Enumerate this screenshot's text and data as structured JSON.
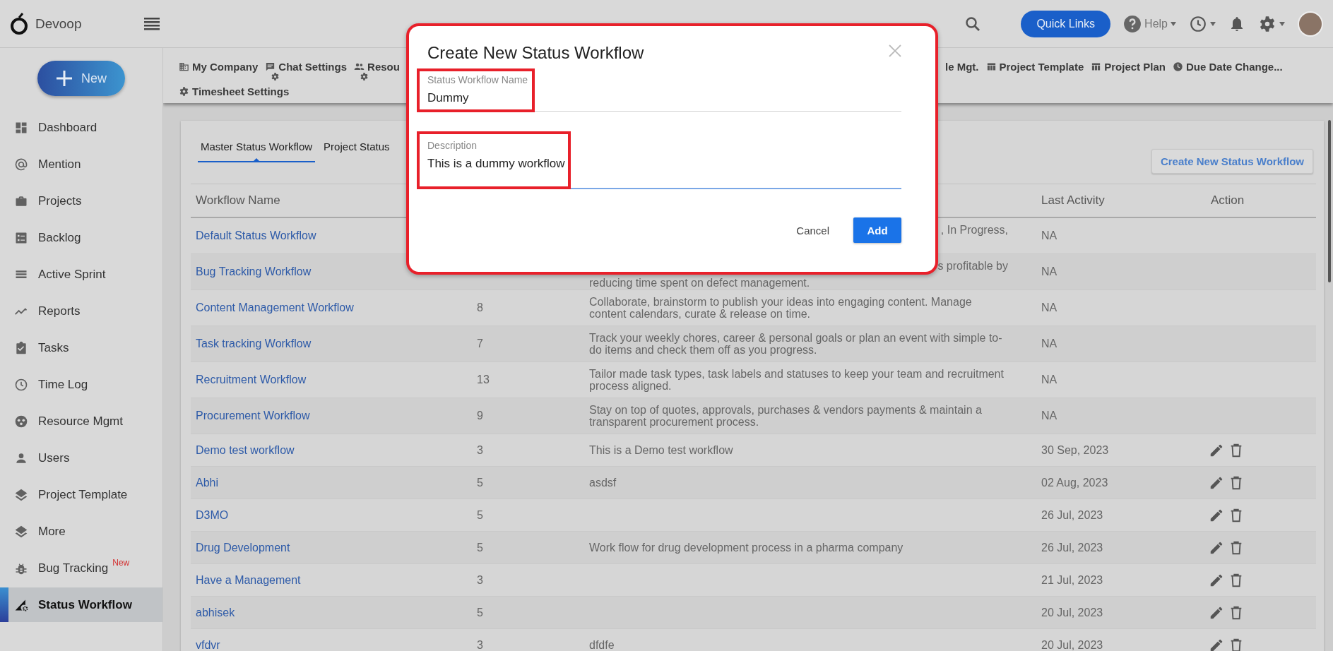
{
  "app": {
    "name": "Devoop"
  },
  "top_bar": {
    "quick_links": "Quick Links",
    "help": "Help"
  },
  "sidebar": {
    "new_button": "New",
    "items": [
      {
        "label": "Dashboard",
        "kind": "dashboard",
        "selected": false
      },
      {
        "label": "Mention",
        "kind": "mention",
        "selected": false
      },
      {
        "label": "Projects",
        "kind": "briefcase",
        "selected": false
      },
      {
        "label": "Backlog",
        "kind": "backlog",
        "selected": false
      },
      {
        "label": "Active Sprint",
        "kind": "sprint",
        "selected": false
      },
      {
        "label": "Reports",
        "kind": "reports",
        "selected": false
      },
      {
        "label": "Tasks",
        "kind": "tasks",
        "selected": false
      },
      {
        "label": "Time Log",
        "kind": "clock",
        "selected": false
      },
      {
        "label": "Resource Mgmt",
        "kind": "resource",
        "selected": false
      },
      {
        "label": "Users",
        "kind": "user",
        "selected": false
      },
      {
        "label": "Project Template",
        "kind": "layers",
        "selected": false
      },
      {
        "label": "More",
        "kind": "layers",
        "selected": false
      },
      {
        "label": "Bug Tracking",
        "kind": "bug",
        "badge": "New",
        "selected": false
      },
      {
        "label": "Status Workflow",
        "kind": "workflow",
        "selected": true
      }
    ]
  },
  "settings_toolbar": {
    "left_items": [
      {
        "label": "My Company",
        "kind": "building",
        "settings_icon": false
      },
      {
        "label": "Chat Settings",
        "kind": "chat",
        "settings_icon": true
      },
      {
        "label": "Resou",
        "kind": "people",
        "settings_icon": true
      }
    ],
    "right_items": [
      {
        "label": "le Mgt.",
        "kind": "none",
        "settings_icon": false
      },
      {
        "label": "Project Template",
        "kind": "table",
        "settings_icon": false
      },
      {
        "label": "Project Plan",
        "kind": "table",
        "settings_icon": false
      },
      {
        "label": "Due Date Change...",
        "kind": "clock",
        "settings_icon": false
      }
    ],
    "second_row_items": [
      {
        "label": "Timesheet Settings",
        "kind": "gear",
        "settings_icon": false
      }
    ]
  },
  "content": {
    "tabs": [
      {
        "label": "Master Status Workflow",
        "selected": true
      },
      {
        "label": "Project Status",
        "selected": false
      }
    ],
    "create_button": "Create New Status Workflow",
    "table": {
      "columns": {
        "workflow_name": "Workflow Name",
        "last_activity": "Last Activity",
        "action": "Action"
      },
      "rows": [
        {
          "name": "Default Status Workflow",
          "description_fragments": [
            {
              "text": ", In Progress,",
              "kind": "tail"
            }
          ],
          "last_activity": "NA",
          "actions": false
        },
        {
          "name": "Bug Tracking Workflow",
          "description_fragments": [
            {
              "text": "s profitable by",
              "kind": "tail"
            },
            {
              "text": "reducing time spent on defect management.",
              "kind": "line"
            }
          ],
          "last_activity": "NA",
          "actions": false
        },
        {
          "name": "Content Management Workflow",
          "count": "8",
          "description": "Collaborate, brainstorm to publish your ideas into engaging content. Manage content calendars, curate & release on time.",
          "last_activity": "NA",
          "actions": false
        },
        {
          "name": "Task tracking Workflow",
          "count": "7",
          "description": "Track your weekly chores, career & personal goals or plan an event with simple to-do items and check them off as you progress.",
          "last_activity": "NA",
          "actions": false
        },
        {
          "name": "Recruitment Workflow",
          "count": "13",
          "description": "Tailor made task types, task labels and statuses to keep your team and recruitment process aligned.",
          "last_activity": "NA",
          "actions": false
        },
        {
          "name": "Procurement Workflow",
          "count": "9",
          "description": "Stay on top of quotes, approvals, purchases & vendors payments & maintain a transparent procurement process.",
          "last_activity": "NA",
          "actions": false
        },
        {
          "name": "Demo test workflow",
          "count": "3",
          "description": "This is a Demo test workflow",
          "last_activity": "30 Sep, 2023",
          "actions": true
        },
        {
          "name": "Abhi",
          "count": "5",
          "description": "asdsf",
          "last_activity": "02 Aug, 2023",
          "actions": true
        },
        {
          "name": "D3MO",
          "count": "5",
          "last_activity": "26 Jul, 2023",
          "actions": true
        },
        {
          "name": "Drug Development",
          "count": "5",
          "description": "Work flow for drug development process in a pharma company",
          "last_activity": "26 Jul, 2023",
          "actions": true
        },
        {
          "name": "Have a Management",
          "count": "3",
          "last_activity": "21 Jul, 2023",
          "actions": true
        },
        {
          "name": "abhisek",
          "count": "5",
          "last_activity": "20 Jul, 2023",
          "actions": true
        },
        {
          "name": "vfdvr",
          "count": "3",
          "description": "dfdfe",
          "last_activity": "20 Jul, 2023",
          "actions": true
        }
      ]
    }
  },
  "dialog": {
    "title": "Create New Status Workflow",
    "fields": [
      {
        "label": "Status Workflow Name",
        "value": "Dummy",
        "focused": false
      },
      {
        "label": "Description",
        "value": "This is a dummy workflow",
        "focused": true
      }
    ],
    "buttons": {
      "cancel": "Cancel",
      "add": "Add"
    }
  }
}
